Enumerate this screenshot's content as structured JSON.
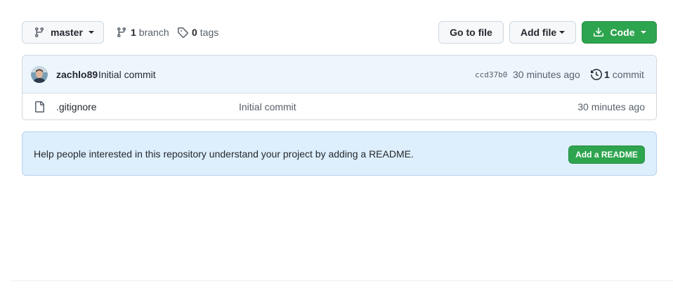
{
  "toolbar": {
    "branch_name": "master",
    "branch_count": "1",
    "branch_label": "branch",
    "tag_count": "0",
    "tag_label": "tags",
    "goto_file_label": "Go to file",
    "add_file_label": "Add file",
    "code_label": "Code"
  },
  "latest_commit": {
    "author": "zachlo89",
    "message": "Initial commit",
    "sha": "ccd37b0",
    "time": "30 minutes ago",
    "commit_count": "1",
    "commit_label": "commit"
  },
  "files": [
    {
      "name": ".gitignore",
      "message": "Initial commit",
      "time": "30 minutes ago"
    }
  ],
  "readme": {
    "text": "Help people interested in this repository understand your project by adding a README.",
    "button_label": "Add a README"
  },
  "colors": {
    "accent_green": "#2da44e",
    "commit_row_bg": "#eef6fd",
    "readme_bg": "#ddeefc"
  }
}
